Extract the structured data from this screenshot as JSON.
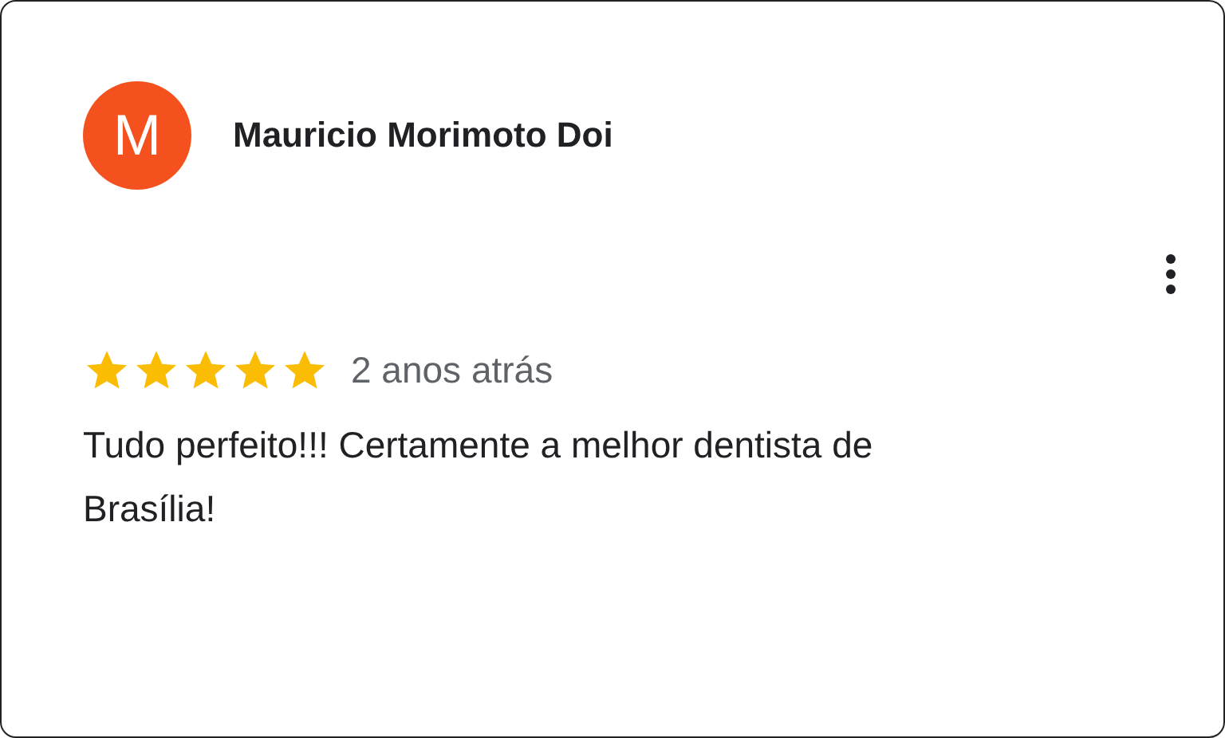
{
  "review": {
    "avatar_letter": "M",
    "author": "Mauricio Morimoto Doi",
    "stars": 5,
    "date": "2 anos atrás",
    "text": "Tudo perfeito!!! Certamente a melhor dentista de Brasília!"
  }
}
